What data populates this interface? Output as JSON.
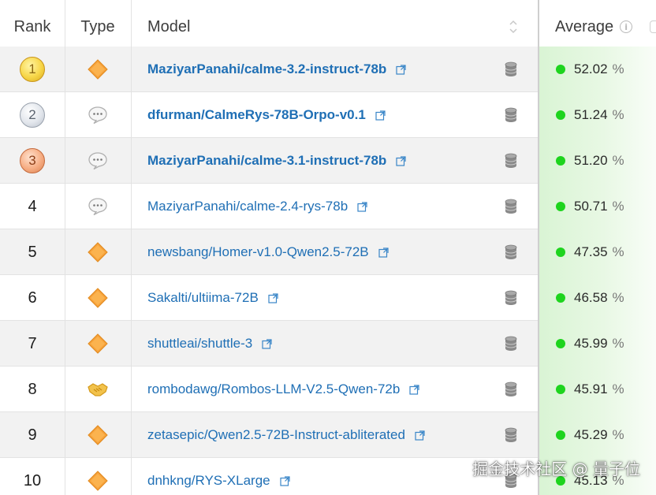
{
  "header": {
    "rank": "Rank",
    "type": "Type",
    "model": "Model",
    "average": "Average",
    "average_info_icon": "info-icon"
  },
  "colors": {
    "model_link": "#1f6fb5",
    "status_dot": "#1ed41e",
    "average_bg": "#d9f4d4",
    "row_shaded": "#f2f2f2"
  },
  "rows": [
    {
      "rank": "1",
      "medal": "gold",
      "type_icon": "diamond-icon",
      "model": "MaziyarPanahi/calme-3.2-instruct-78b",
      "bold": true,
      "average": "52.02",
      "unit": "%"
    },
    {
      "rank": "2",
      "medal": "silver",
      "type_icon": "chat-bubble-icon",
      "model": "dfurman/CalmeRys-78B-Orpo-v0.1",
      "bold": true,
      "average": "51.24",
      "unit": "%"
    },
    {
      "rank": "3",
      "medal": "bronze",
      "type_icon": "chat-bubble-icon",
      "model": "MaziyarPanahi/calme-3.1-instruct-78b",
      "bold": true,
      "average": "51.20",
      "unit": "%"
    },
    {
      "rank": "4",
      "type_icon": "chat-bubble-icon",
      "model": "MaziyarPanahi/calme-2.4-rys-78b",
      "average": "50.71",
      "unit": "%"
    },
    {
      "rank": "5",
      "type_icon": "diamond-icon",
      "model": "newsbang/Homer-v1.0-Qwen2.5-72B",
      "average": "47.35",
      "unit": "%"
    },
    {
      "rank": "6",
      "type_icon": "diamond-icon",
      "model": "Sakalti/ultiima-72B",
      "average": "46.58",
      "unit": "%"
    },
    {
      "rank": "7",
      "type_icon": "diamond-icon",
      "model": "shuttleai/shuttle-3",
      "average": "45.99",
      "unit": "%"
    },
    {
      "rank": "8",
      "type_icon": "handshake-icon",
      "model": "rombodawg/Rombos-LLM-V2.5-Qwen-72b",
      "average": "45.91",
      "unit": "%"
    },
    {
      "rank": "9",
      "type_icon": "diamond-icon",
      "model": "zetasepic/Qwen2.5-72B-Instruct-abliterated",
      "average": "45.29",
      "unit": "%"
    },
    {
      "rank": "10",
      "type_icon": "diamond-icon",
      "model": "dnhkng/RYS-XLarge",
      "average": "45.13",
      "unit": "%"
    }
  ],
  "watermark": "掘金技术社区 @ 量子位"
}
